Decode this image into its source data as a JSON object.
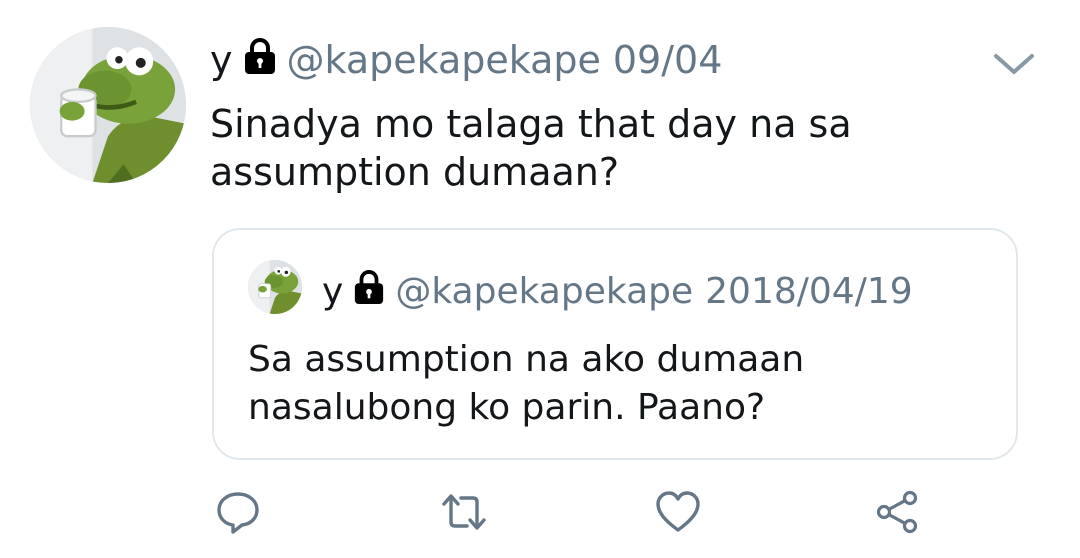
{
  "tweet": {
    "name": "y",
    "handle": "@kapekapekape",
    "date": "09/04",
    "text": "Sinadya mo talaga that day na sa assumption dumaan?",
    "icons": {
      "lock": "lock-icon",
      "menu": "chevron-down-icon"
    }
  },
  "quoted": {
    "name": "y",
    "handle": "@kapekapekape",
    "date": "2018/04/19",
    "text": "Sa assumption na ako dumaan nasalubong ko parin. Paano?"
  },
  "actions": {
    "reply": "reply-icon",
    "retweet": "retweet-icon",
    "like": "heart-icon",
    "share": "share-icon"
  },
  "colors": {
    "text": "#14171a",
    "secondary": "#657786",
    "border": "#e1e8ed",
    "icon": "#657786"
  }
}
